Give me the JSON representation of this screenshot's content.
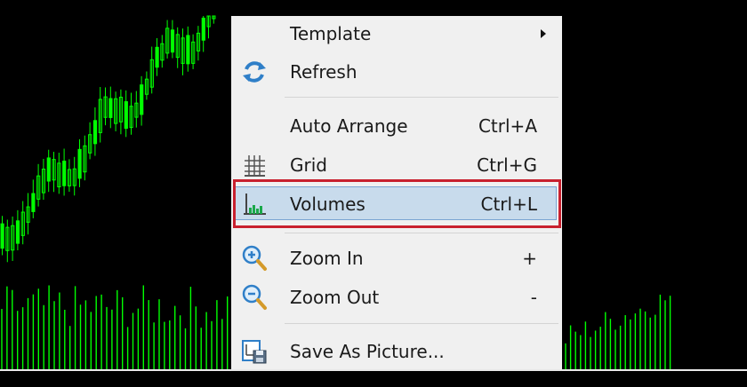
{
  "menu": {
    "items": [
      {
        "id": "template",
        "label": "Template",
        "shortcut": "",
        "icon": "none",
        "submenu": true
      },
      {
        "id": "refresh",
        "label": "Refresh",
        "shortcut": "",
        "icon": "refresh-icon",
        "submenu": false
      },
      {
        "id": "auto-arrange",
        "label": "Auto Arrange",
        "shortcut": "Ctrl+A",
        "icon": "none",
        "submenu": false
      },
      {
        "id": "grid",
        "label": "Grid",
        "shortcut": "Ctrl+G",
        "icon": "grid-icon",
        "submenu": false
      },
      {
        "id": "volumes",
        "label": "Volumes",
        "shortcut": "Ctrl+L",
        "icon": "volumes-icon",
        "submenu": false,
        "highlighted": true
      },
      {
        "id": "zoom-in",
        "label": "Zoom In",
        "shortcut": "+",
        "icon": "zoom-in-icon",
        "submenu": false
      },
      {
        "id": "zoom-out",
        "label": "Zoom Out",
        "shortcut": "-",
        "icon": "zoom-out-icon",
        "submenu": false
      },
      {
        "id": "save-as-picture",
        "label": "Save As Picture...",
        "shortcut": "",
        "icon": "save-picture-icon",
        "submenu": false
      }
    ]
  },
  "colors": {
    "chart_background": "#000000",
    "candle_color": "#00ff00",
    "volume_color": "#00ff00",
    "menu_background": "#f0f0f0",
    "highlight_fill": "#c8dbec",
    "highlight_border": "#7aa5d2",
    "annotation_border": "#c8202e"
  }
}
